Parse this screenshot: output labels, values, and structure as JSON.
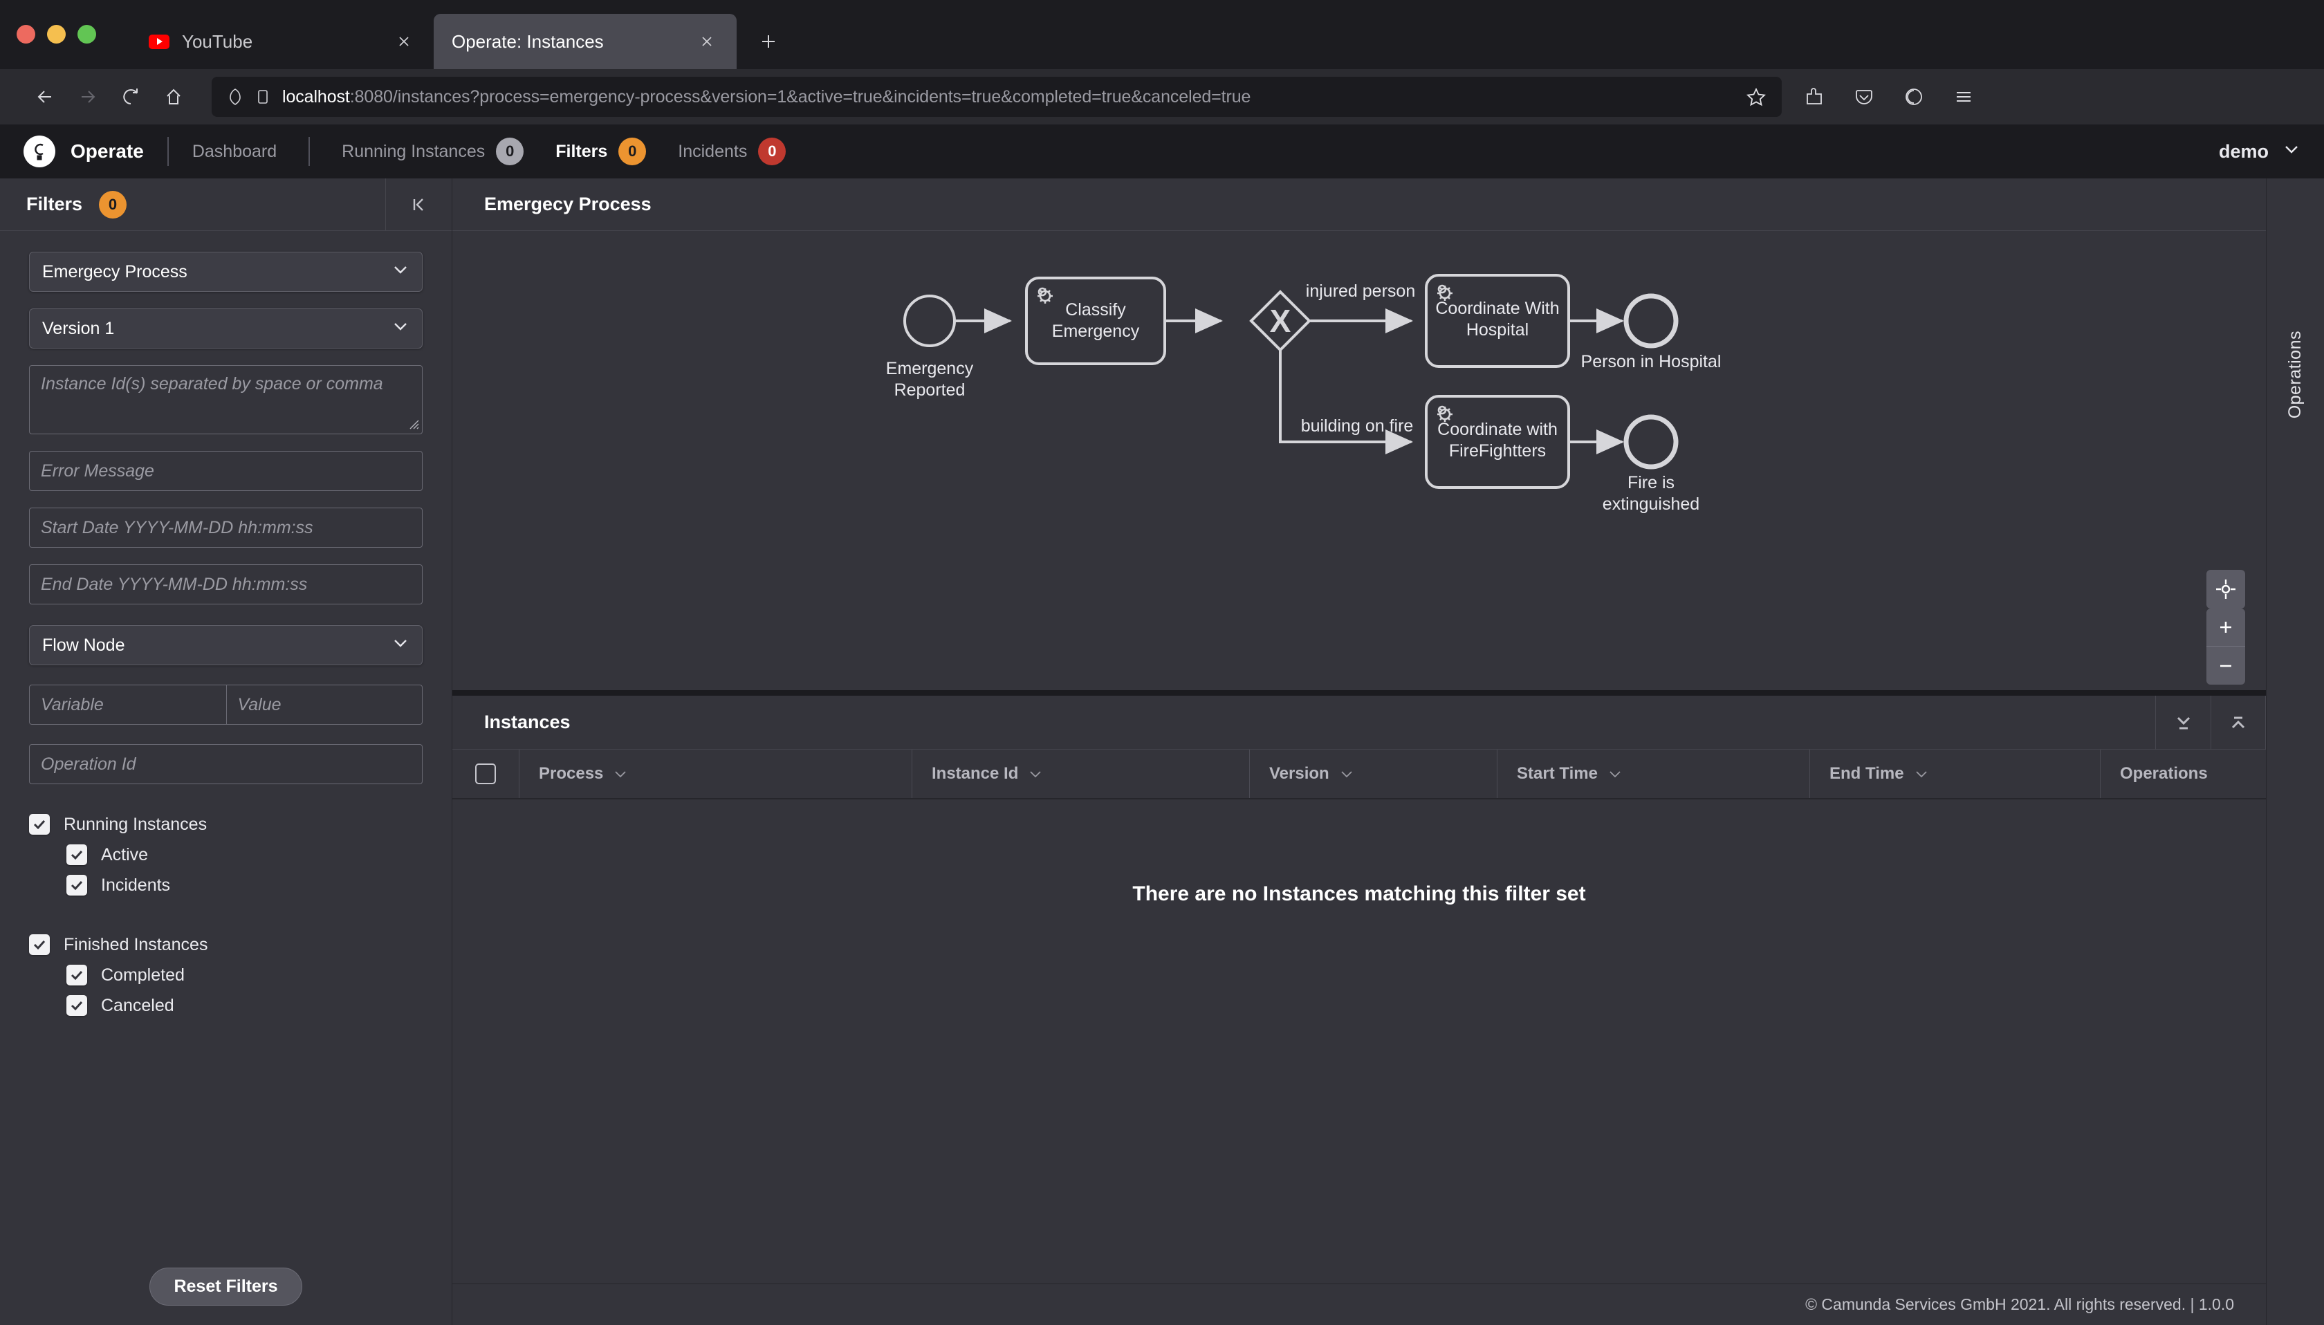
{
  "browser": {
    "tabs": [
      {
        "title": "YouTube",
        "favicon": "youtube-icon",
        "active": false
      },
      {
        "title": "Operate: Instances",
        "favicon": "none",
        "active": true
      }
    ],
    "newtab_label": "+",
    "url_host": "localhost",
    "url_rest": ":8080/instances?process=emergency-process&version=1&active=true&incidents=true&completed=true&canceled=true",
    "icons": {
      "back": "back-arrow-icon",
      "forward": "forward-arrow-icon",
      "reload": "reload-icon",
      "home": "home-icon",
      "shield": "shield-icon",
      "page": "page-icon",
      "bookmark_star": "star-icon",
      "extensions": "extensions-icon",
      "pocket": "pocket-icon",
      "account": "account-icon",
      "menu": "hamburger-menu-icon"
    }
  },
  "appheader": {
    "logo": "camunda-logo-icon",
    "brand": "Operate",
    "navlinks": [
      {
        "label": "Dashboard",
        "badge": null,
        "badge_color": null,
        "active": false
      },
      {
        "label": "Running Instances",
        "badge": "0",
        "badge_color": "#a8a8b0",
        "active": false
      },
      {
        "label": "Filters",
        "badge": "0",
        "badge_color": "#ec9430",
        "active": true
      },
      {
        "label": "Incidents",
        "badge": "0",
        "badge_color": "#c0392f",
        "active": false
      }
    ],
    "user": "demo",
    "user_chevron": "chevron-down-icon"
  },
  "sidebar": {
    "title": "Filters",
    "badge": "0",
    "collapse_icon": "collapse-left-icon",
    "process_select": {
      "value": "Emergecy Process",
      "chevron": "chevron-down-icon"
    },
    "version_select": {
      "value": "Version 1",
      "chevron": "chevron-down-icon"
    },
    "instance_ids": {
      "value": "",
      "placeholder": "Instance Id(s) separated by space or comma"
    },
    "error_message": {
      "value": "",
      "placeholder": "Error Message"
    },
    "start_date": {
      "value": "",
      "placeholder": "Start Date YYYY-MM-DD hh:mm:ss"
    },
    "end_date": {
      "value": "",
      "placeholder": "End Date YYYY-MM-DD hh:mm:ss"
    },
    "flow_node_select": {
      "value": "Flow Node",
      "chevron": "chevron-down-icon"
    },
    "variable": {
      "value": "",
      "placeholder": "Variable"
    },
    "variable_value": {
      "value": "",
      "placeholder": "Value"
    },
    "operation_id": {
      "value": "",
      "placeholder": "Operation Id"
    },
    "checkboxes": [
      {
        "label": "Running Instances",
        "checked": true,
        "indent": false
      },
      {
        "label": "Active",
        "checked": true,
        "indent": true
      },
      {
        "label": "Incidents",
        "checked": true,
        "indent": true
      },
      {
        "label": "Finished Instances",
        "checked": true,
        "indent": false
      },
      {
        "label": "Completed",
        "checked": true,
        "indent": true
      },
      {
        "label": "Canceled",
        "checked": true,
        "indent": true
      }
    ],
    "reset_label": "Reset Filters"
  },
  "diagram": {
    "title": "Emergecy Process",
    "zoom_reset_icon": "crosshair-reset-icon",
    "zoom_in_icon": "plus-icon",
    "zoom_out_icon": "minus-icon",
    "nodes": [
      {
        "id": "start",
        "type": "start-event",
        "label": "Emergency\nReported"
      },
      {
        "id": "classify",
        "type": "service-task",
        "label": "Classify\nEmergency"
      },
      {
        "id": "gateway",
        "type": "exclusive-gateway",
        "label": "X"
      },
      {
        "id": "hospital",
        "type": "service-task",
        "label": "Coordinate With\nHospital"
      },
      {
        "id": "endHospital",
        "type": "end-event",
        "label": "Person in Hospital"
      },
      {
        "id": "firefighters",
        "type": "service-task",
        "label": "Coordinate with\nFireFightters"
      },
      {
        "id": "endFire",
        "type": "end-event",
        "label": "Fire is\nextinguished"
      }
    ],
    "flow_labels": [
      "injured person",
      "building on fire"
    ]
  },
  "operations_rail": {
    "label": "Operations"
  },
  "instances": {
    "title": "Instances",
    "expand_down_icon": "expand-down-icon",
    "collapse_up_icon": "collapse-up-icon",
    "columns": [
      {
        "label": "Process",
        "sortable": true
      },
      {
        "label": "Instance Id",
        "sortable": true
      },
      {
        "label": "Version",
        "sortable": true
      },
      {
        "label": "Start Time",
        "sortable": true
      },
      {
        "label": "End Time",
        "sortable": true
      },
      {
        "label": "Operations",
        "sortable": false
      }
    ],
    "rows": [],
    "empty_message": "There are no Instances matching this filter set"
  },
  "footer": {
    "text": "© Camunda Services GmbH 2021. All rights reserved. | 1.0.0"
  },
  "colors": {
    "accent_orange": "#ec9430",
    "accent_red": "#c0392f",
    "badge_grey": "#a8a8b0",
    "panel_bg": "#34343b",
    "app_bg": "#1b1b1f"
  }
}
